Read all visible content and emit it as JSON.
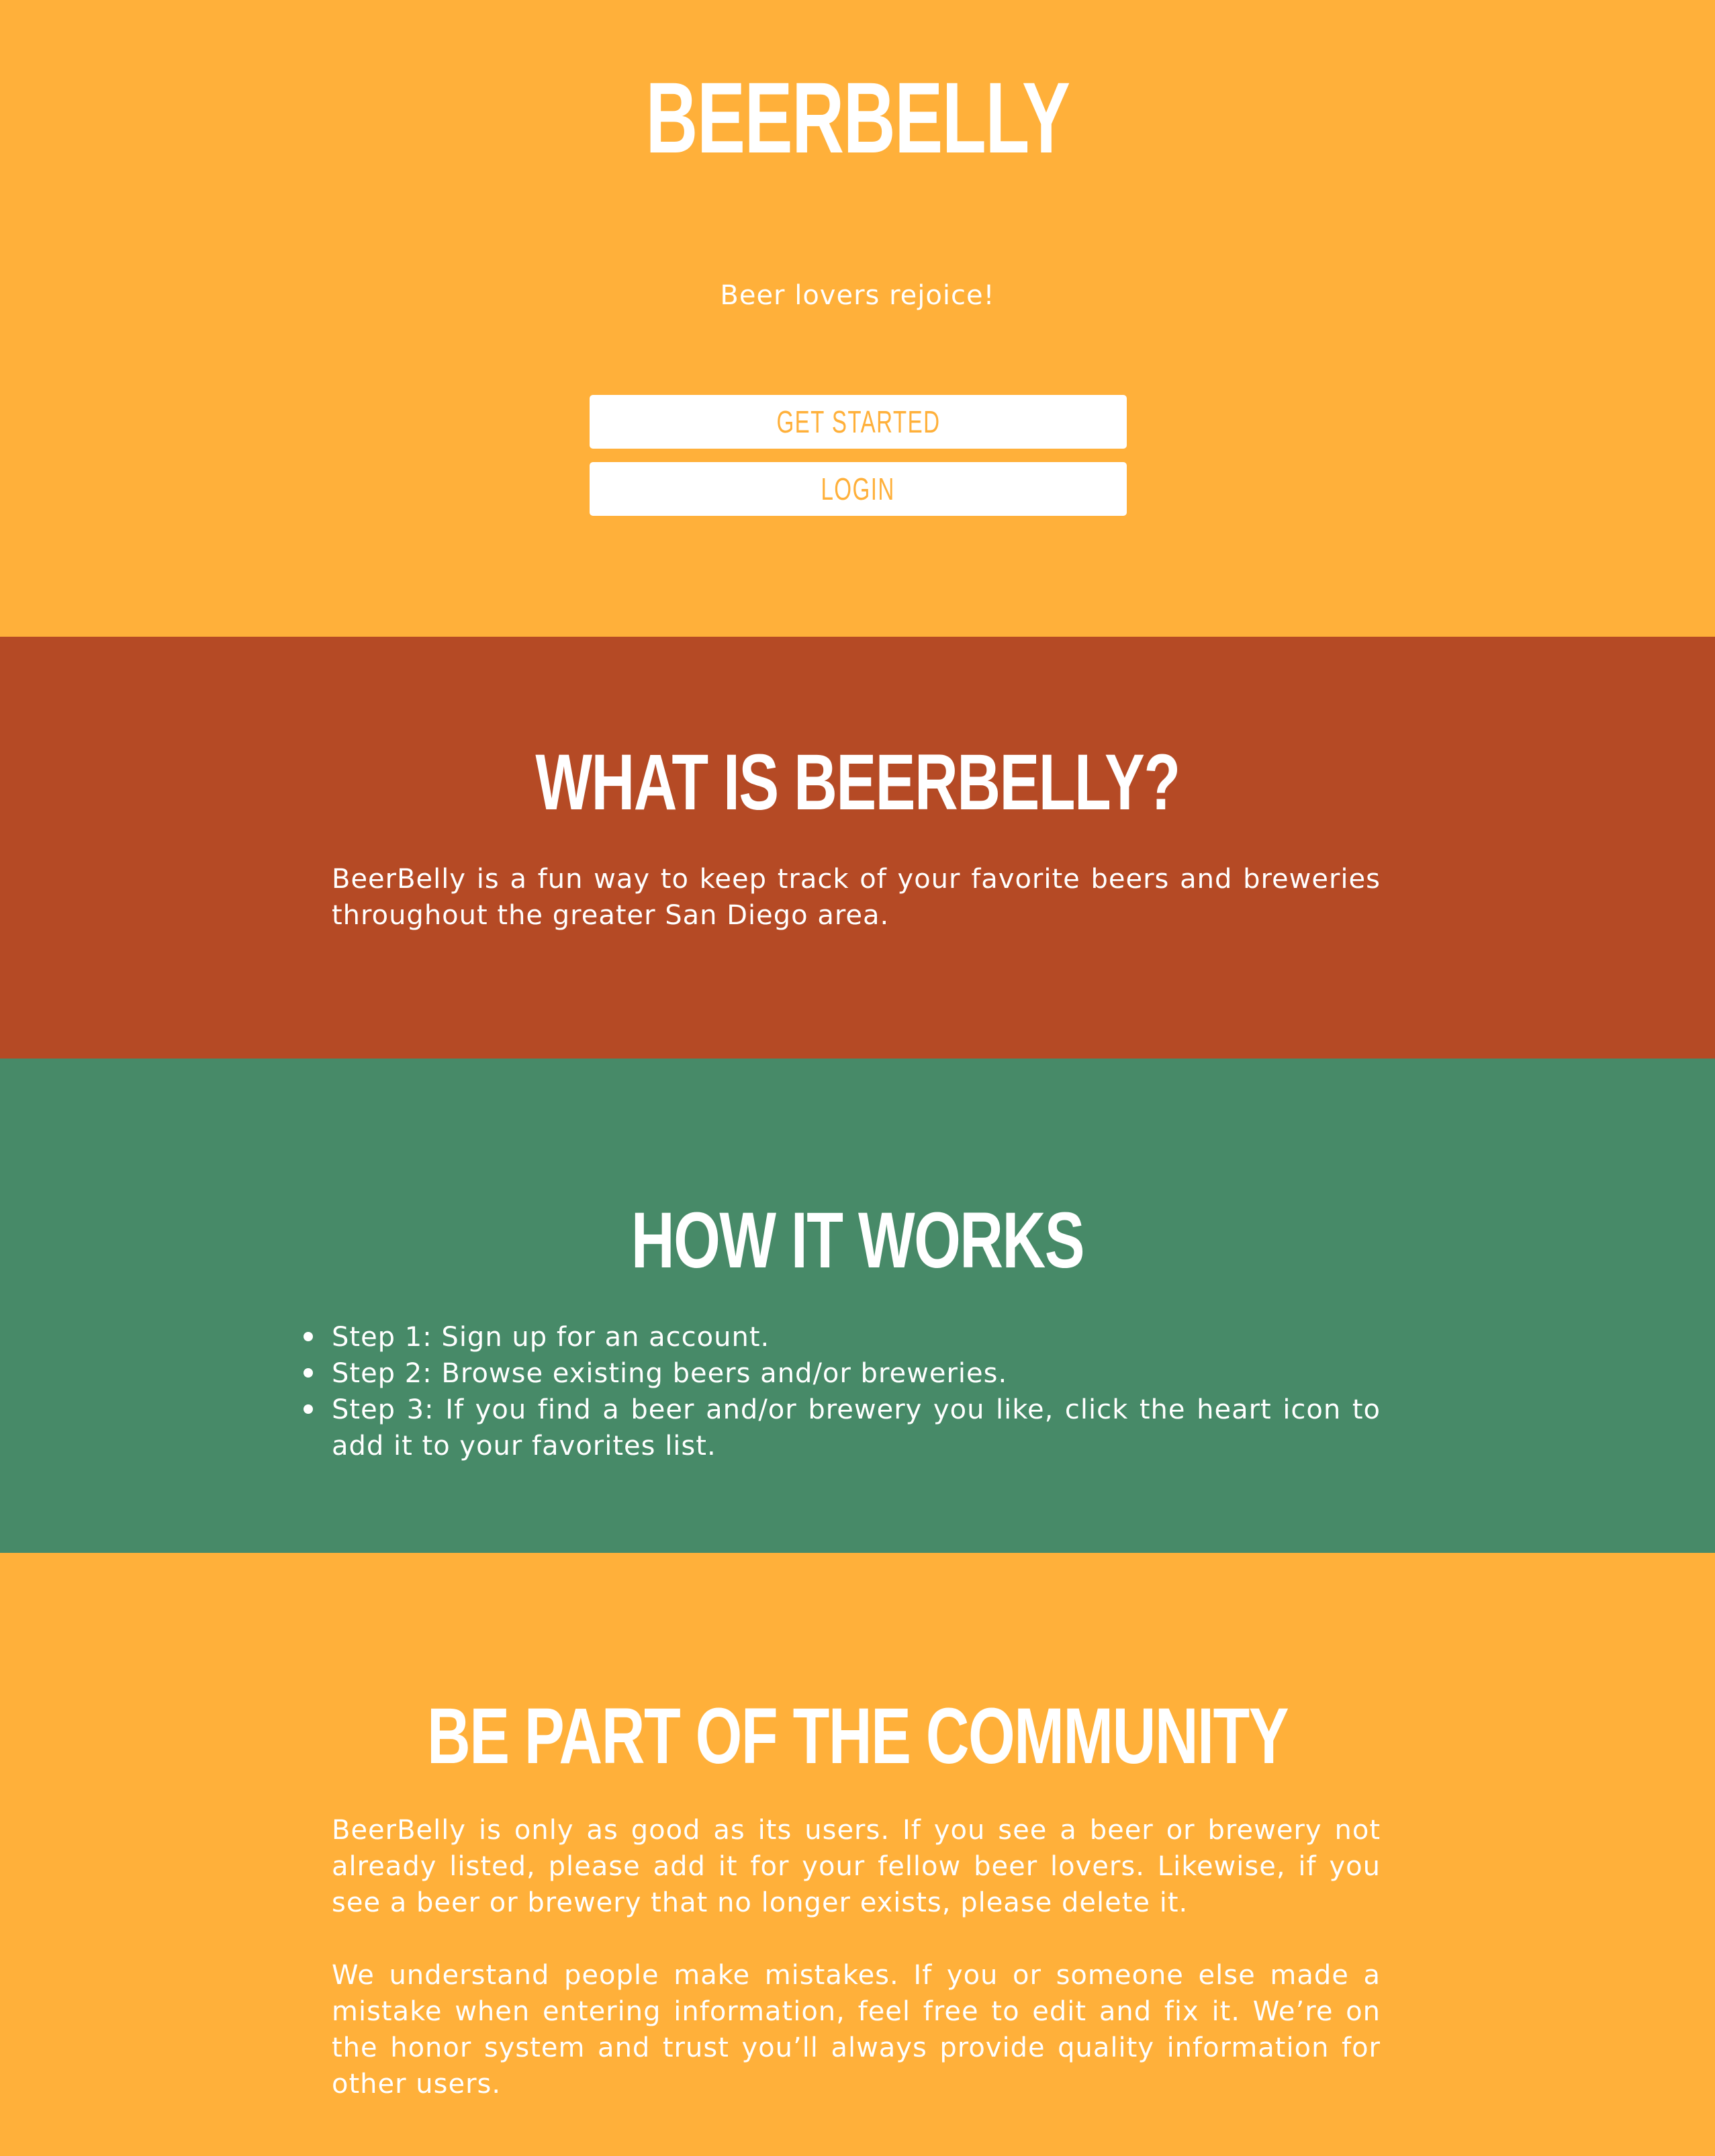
{
  "colors": {
    "orange": "#ffb03a",
    "rust": "#b54a25",
    "green": "#478a68",
    "white": "#ffffff"
  },
  "hero": {
    "title": "BeerBelly",
    "tagline": "Beer lovers rejoice!",
    "get_started_label": "Get Started",
    "login_label": "Login"
  },
  "about": {
    "heading": "What is BeerBelly?",
    "body": "BeerBelly is a fun way to keep track of your favorite beers and breweries throughout the greater San Diego area."
  },
  "how": {
    "heading": "How it works",
    "steps": [
      "Step 1: Sign up for an account.",
      "Step 2: Browse existing beers and/or breweries.",
      "Step 3: If you find a beer and/or brewery you like, click the heart icon to add it to your favorites list."
    ]
  },
  "community": {
    "heading": "Be part of the community",
    "paragraphs": [
      "BeerBelly is only as good as its users. If you see a beer or brewery not already listed, please add it for your fellow beer lovers. Likewise, if you see a beer or brewery that no longer exists, please delete it.",
      "We understand people make mistakes. If you or someone else made a mistake when entering information, feel free to edit and fix it. We’re on the honor system and trust you’ll always provide quality information for other users."
    ]
  }
}
